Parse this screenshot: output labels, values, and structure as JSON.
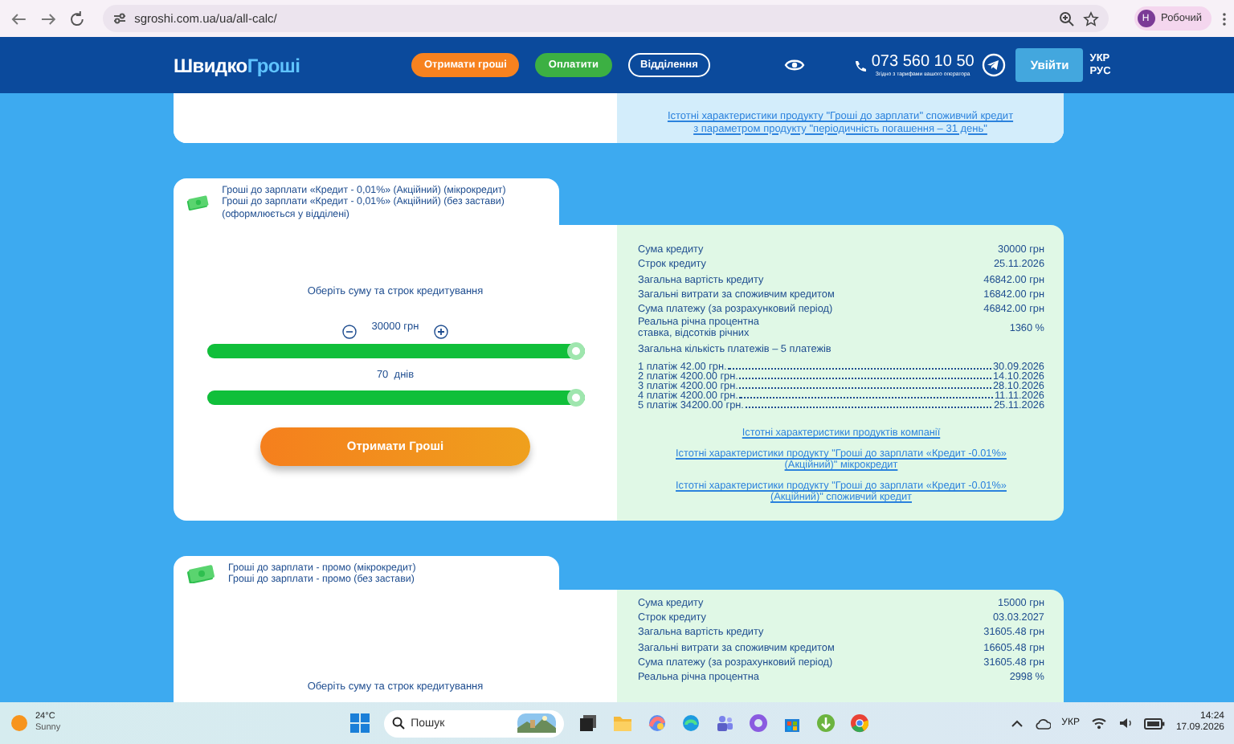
{
  "browser": {
    "url": "sgroshi.com.ua/ua/all-calc/",
    "profile_initial": "Н",
    "profile": "Робочий"
  },
  "header": {
    "logo": [
      "Швидко",
      "Гроші"
    ],
    "nav": [
      {
        "label": "Отримати гроші",
        "kind": "orange"
      },
      {
        "label": "Оплатити",
        "kind": "green"
      },
      {
        "label": "Відділення",
        "kind": "outline"
      }
    ],
    "phone": "073 560 10 50",
    "phone_note": "Згідно з тарифами вашого оператора",
    "login": "Увійти",
    "languages": [
      "УКР",
      "РУС"
    ]
  },
  "top_card": {
    "links": [
      "Істотні характеристики продукту \"Гроші до зарплати\" споживчий кредит з параметром продукту \"періодичність погашення – 31 день\""
    ]
  },
  "cards": [
    {
      "title_lines": [
        "Гроші до зарплати «Кредит - 0,01%» (Акційний) (мікрокредит)",
        "Гроші до зарплати «Кредит - 0,01%» (Акційний) (без застави) (оформлюється у відділені)"
      ],
      "prompt": "Оберіть суму та строк кредитування",
      "amount": "30000 грн",
      "amount_slider": {
        "level": 1
      },
      "term": "70  днів",
      "term_slider": {
        "level": 1
      },
      "button": "Отримати Гроші",
      "summary": [
        {
          "label": "Сума кредиту",
          "value": "30000 грн"
        },
        {
          "label": "Строк кредиту",
          "value": "25.11.2026"
        },
        {
          "label": "Загальна вартість кредиту",
          "value": "46842.00 грн"
        },
        {
          "label": "Загальні витрати за споживчим кредитом",
          "value": "16842.00 грн"
        },
        {
          "label": "Сума платежу (за розрахунковий період)",
          "value": "46842.00 грн"
        },
        {
          "label": "Реальна річна процентна\nставка, відсотків річних",
          "value": "1360 %"
        }
      ],
      "payments_total": "Загальна кількість платежів – 5 платежів",
      "payments": [
        {
          "label": "1 платіж 42.00 грн.",
          "date": "30.09.2026"
        },
        {
          "label": "2 платіж 4200.00 грн.",
          "date": "14.10.2026"
        },
        {
          "label": "3 платіж 4200.00 грн.",
          "date": "28.10.2026"
        },
        {
          "label": "4 платіж 4200.00 грн.",
          "date": "11.11.2026"
        },
        {
          "label": "5 платіж 34200.00 грн.",
          "date": "25.11.2026"
        }
      ],
      "links": [
        "Істотні характеристики продуктів компанії",
        "Істотні характеристики продукту \"Гроші до зарплати «Кредит -0.01%» (Акційний)\" мікрокредит",
        "Істотні характеристики продукту \"Гроші до зарплати «Кредит -0.01%» (Акційний)\" споживчий кредит"
      ]
    },
    {
      "title_lines": [
        "Гроші до зарплати - промо (мікрокредит)",
        "Гроші до зарплати - промо (без застави)"
      ],
      "prompt": "Оберіть суму та строк кредитування",
      "summary": [
        {
          "label": "Сума кредиту",
          "value": "15000 грн"
        },
        {
          "label": "Строк кредиту",
          "value": "03.03.2027"
        },
        {
          "label": "Загальна вартість кредиту",
          "value": "31605.48 грн"
        },
        {
          "label": "Загальні витрати за споживчим кредитом",
          "value": "16605.48 грн"
        },
        {
          "label": "Сума платежу (за розрахунковий період)",
          "value": "31605.48 грн"
        },
        {
          "label": "Реальна річна процентна",
          "value": "2998 %"
        }
      ]
    }
  ],
  "taskbar": {
    "temperature": "24°C",
    "weather": "Sunny",
    "search_placeholder": "Пошук",
    "language": "УКР",
    "time": "14:24",
    "date": "17.09.2026"
  }
}
